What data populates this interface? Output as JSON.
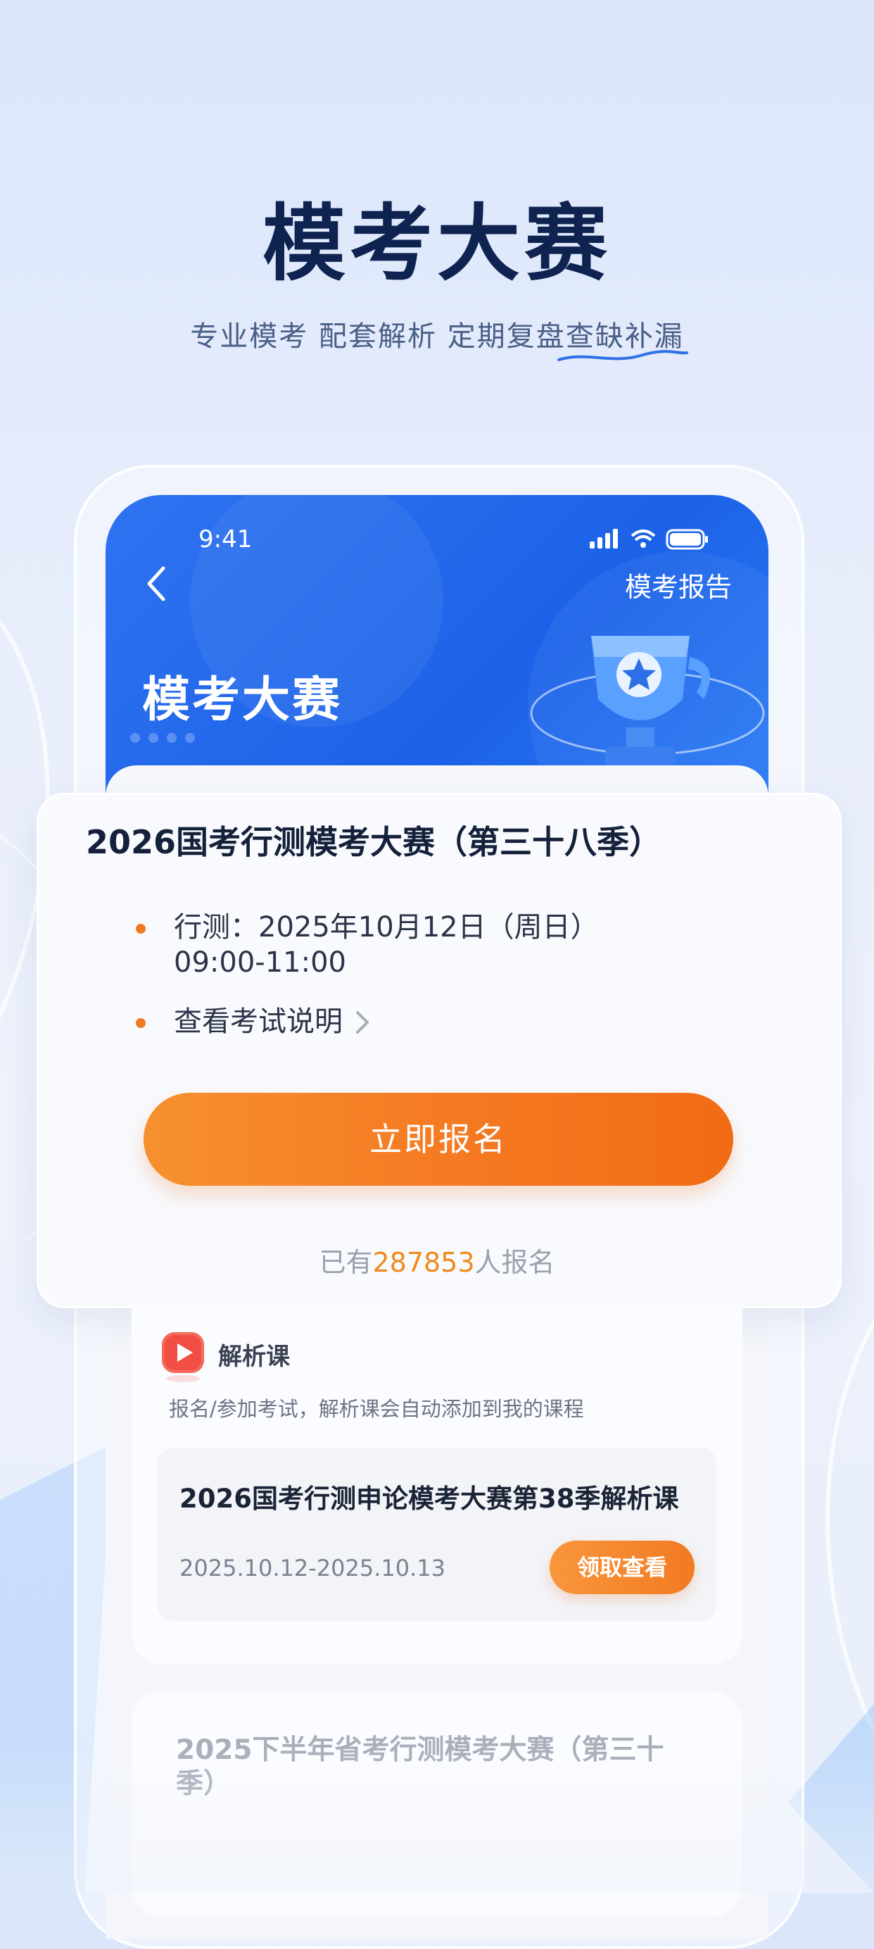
{
  "hero": {
    "title": "模考大赛",
    "subtitle": "专业模考 配套解析 定期复盘查缺补漏"
  },
  "status_bar": {
    "time": "9:41"
  },
  "app_header": {
    "report_link": "模考报告",
    "title": "模考大赛"
  },
  "exam_card": {
    "title": "2026国考行测模考大赛（第三十八季）",
    "schedule_line1": "行测：2025年10月12日（周日）",
    "schedule_line2": "09:00-11:00",
    "instructions_link": "查看考试说明",
    "cta_label": "立即报名",
    "reg_prefix": "已有",
    "reg_count": "287853",
    "reg_suffix": "人报名"
  },
  "analysis_course": {
    "label": "解析课",
    "description": "报名/参加考试，解析课会自动添加到我的课程",
    "course_name": "2026国考行测申论模考大赛第38季解析课",
    "date_range": "2025.10.12-2025.10.13",
    "button_label": "领取查看"
  },
  "next_competition": {
    "title": "2025下半年省考行测模考大赛（第三十季）"
  },
  "colors": {
    "accent_orange": "#f57b22",
    "header_blue": "#2e73f0",
    "title_navy": "#0f2350"
  }
}
